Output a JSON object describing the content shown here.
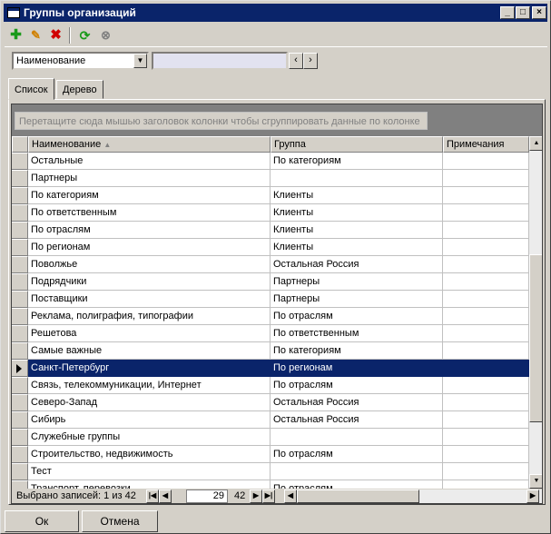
{
  "window": {
    "title": "Группы организаций"
  },
  "toolbar": {
    "add": "add-icon",
    "edit": "pencil-icon",
    "delete": "delete-icon",
    "refresh": "refresh-icon",
    "cancel": "cancel-icon"
  },
  "filter": {
    "field": "Наименование",
    "value": ""
  },
  "tabs": [
    {
      "label": "Список",
      "active": true
    },
    {
      "label": "Дерево",
      "active": false
    }
  ],
  "grid": {
    "group_hint": "Перетащите сюда мышью заголовок колонки чтобы сгруппировать данные по колонке",
    "columns": [
      "Наименование",
      "Группа",
      "Примечания"
    ],
    "sort_column": "Наименование",
    "rows": [
      [
        "Остальные",
        "По категориям",
        ""
      ],
      [
        "Партнеры",
        "",
        ""
      ],
      [
        "По категориям",
        "Клиенты",
        ""
      ],
      [
        "По ответственным",
        "Клиенты",
        ""
      ],
      [
        "По отраслям",
        "Клиенты",
        ""
      ],
      [
        "По регионам",
        "Клиенты",
        ""
      ],
      [
        "Поволжье",
        "Остальная Россия",
        ""
      ],
      [
        "Подрядчики",
        "Партнеры",
        ""
      ],
      [
        "Поставщики",
        "Партнеры",
        ""
      ],
      [
        "Реклама, полиграфия, типографии",
        "По отраслям",
        ""
      ],
      [
        "Решетова",
        "По ответственным",
        ""
      ],
      [
        "Самые важные",
        "По категориям",
        ""
      ],
      [
        "Санкт-Петербург",
        "По регионам",
        ""
      ],
      [
        "Связь, телекоммуникации, Интернет",
        "По отраслям",
        ""
      ],
      [
        "Северо-Запад",
        "Остальная Россия",
        ""
      ],
      [
        "Сибирь",
        "Остальная Россия",
        ""
      ],
      [
        "Служебные группы",
        "",
        ""
      ],
      [
        "Строительство, недвижимость",
        "По отраслям",
        ""
      ],
      [
        "Тест",
        "",
        ""
      ],
      [
        "Транспорт, перевозки",
        "По отраслям",
        ""
      ]
    ],
    "selected_row": 12
  },
  "status": {
    "selected_text": "Выбрано записей: 1 из 42",
    "page": "29",
    "total": "42"
  },
  "buttons": {
    "ok": "Ок",
    "cancel": "Отмена"
  },
  "colors": {
    "titlebar": "#0a246a",
    "selection": "#0a246a",
    "face": "#d4d0c8"
  }
}
